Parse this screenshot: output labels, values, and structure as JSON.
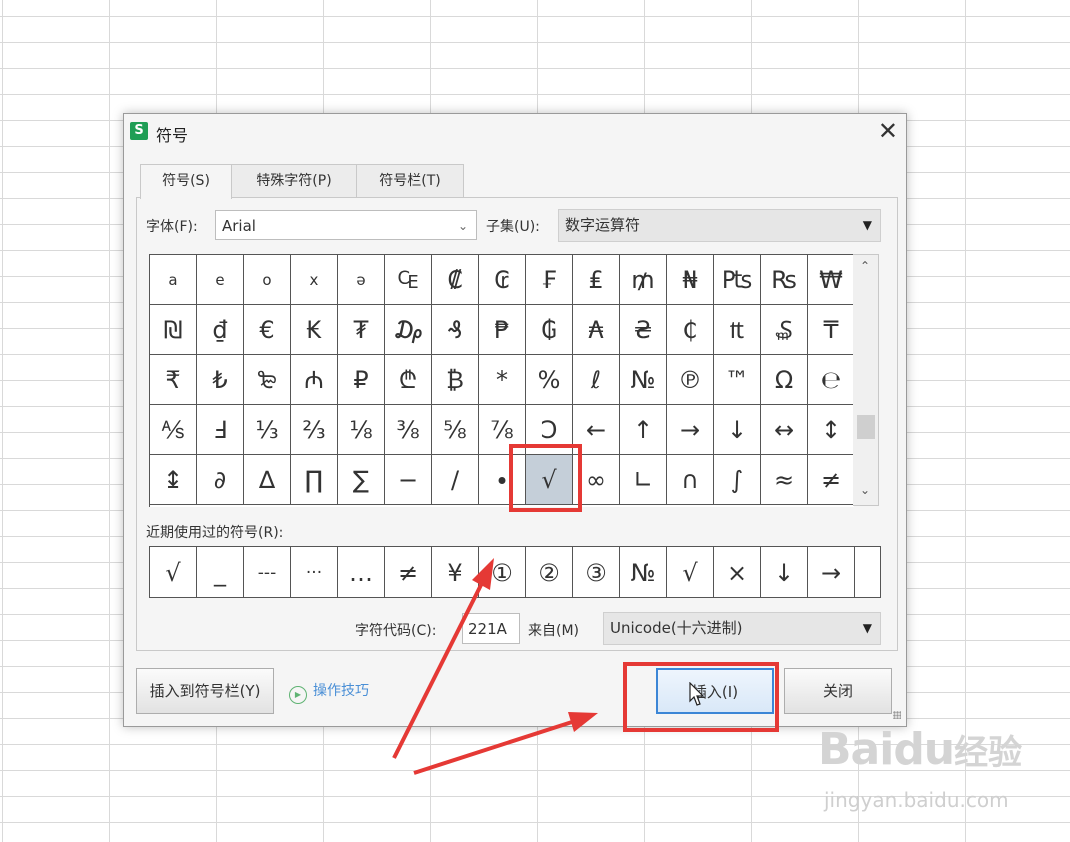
{
  "dialog": {
    "title": "符号",
    "app_icon": "S",
    "close_glyph": "✕"
  },
  "tabs": [
    {
      "label": "符号(S)"
    },
    {
      "label": "特殊字符(P)"
    },
    {
      "label": "符号栏(T)"
    }
  ],
  "font": {
    "label": "字体(F):",
    "value": "Arial"
  },
  "subset": {
    "label": "子集(U):",
    "value": "数字运算符"
  },
  "symbols": [
    [
      "a",
      "e",
      "o",
      "x",
      "ə",
      "₠",
      "₡",
      "₢",
      "₣",
      "₤",
      "₥",
      "₦",
      "₧",
      "₨",
      "₩"
    ],
    [
      "₪",
      "₫",
      "€",
      "₭",
      "₮",
      "₯",
      "₰",
      "₱",
      "₲",
      "₳",
      "₴",
      "₵",
      "₶",
      "₷",
      "₸"
    ],
    [
      "₹",
      "₺",
      "₻",
      "₼",
      "₽",
      "₾",
      "₿",
      "*",
      "%",
      "ℓ",
      "№",
      "℗",
      "™",
      "Ω",
      "℮"
    ],
    [
      "⅍",
      "Ⅎ",
      "⅓",
      "⅔",
      "⅛",
      "⅜",
      "⅝",
      "⅞",
      "Ↄ",
      "←",
      "↑",
      "→",
      "↓",
      "↔",
      "↕"
    ],
    [
      "↨",
      "∂",
      "∆",
      "∏",
      "∑",
      "−",
      "∕",
      "∙",
      "√",
      "∞",
      "∟",
      "∩",
      "∫",
      "≈",
      "≠"
    ]
  ],
  "selected_symbol": "√",
  "recent": {
    "label": "近期使用过的符号(R):",
    "items": [
      "√",
      "_",
      "---",
      "···",
      "…",
      "≠",
      "¥",
      "①",
      "②",
      "③",
      "№",
      "√",
      "×",
      "↓",
      "→"
    ]
  },
  "char_code": {
    "label": "字符代码(C):",
    "value": "221A"
  },
  "from": {
    "label": "来自(M)",
    "value": "Unicode(十六进制)"
  },
  "buttons": {
    "insert_to_bar": "插入到符号栏(Y)",
    "tips": "操作技巧",
    "insert": "插入(I)",
    "close": "关闭"
  },
  "watermark": {
    "brand": "Bai",
    "brand2": "du",
    "cn": "经验",
    "url": "jingyan.baidu.com"
  },
  "colors": {
    "highlight": "#e53935",
    "accent_blue": "#3c86d6",
    "app_green": "#1f9e55"
  }
}
